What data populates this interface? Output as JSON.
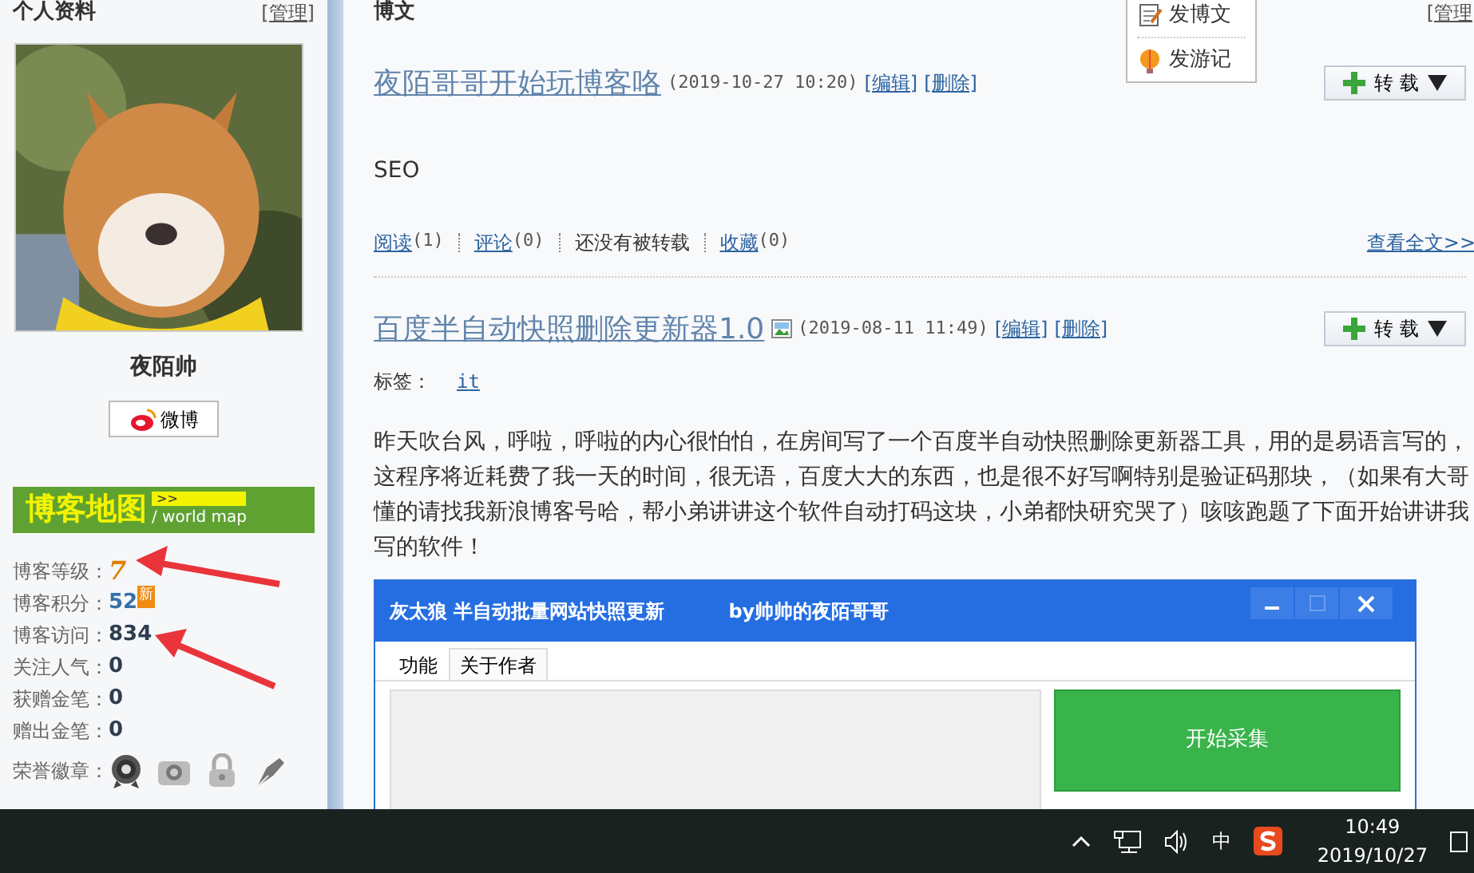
{
  "sidebar": {
    "title": "个人资料",
    "manage": "[管理]",
    "name": "夜陌帅",
    "weibo": "微博",
    "blog_map": {
      "title": "博客地图",
      "arrow": ">>",
      "subtitle": "/ world map"
    },
    "stats": [
      {
        "label": "博客等级：",
        "value": "7",
        "kind": "level"
      },
      {
        "label": "博客积分：",
        "value": "52",
        "kind": "points",
        "badge": "新"
      },
      {
        "label": "博客访问：",
        "value": "834",
        "kind": "plain"
      },
      {
        "label": "关注人气：",
        "value": "0",
        "kind": "plain"
      },
      {
        "label": "获赠金笔：",
        "value": "0",
        "kind": "plain"
      },
      {
        "label": "赠出金笔：",
        "value": "0",
        "kind": "plain"
      }
    ],
    "badges_label": "荣誉徽章："
  },
  "main": {
    "title": "博文",
    "manage": "[管理",
    "menu": [
      "发博文",
      "发游记"
    ],
    "posts": [
      {
        "title": "夜陌哥哥开始玩博客咯",
        "has_image": false,
        "date": "(2019-10-27 10:20)",
        "edit": "[编辑]",
        "delete": "[删除]",
        "share": "转 载",
        "body": "SEO",
        "actions": [
          {
            "kind": "link",
            "label": "阅读",
            "count": "(1)"
          },
          {
            "kind": "link",
            "label": "评论",
            "count": "(0)"
          },
          {
            "kind": "text",
            "label": "还没有被转载"
          },
          {
            "kind": "link",
            "label": "收藏",
            "count": "(0)"
          }
        ],
        "more": "查看全文>>"
      },
      {
        "title": "百度半自动快照删除更新器1.0",
        "has_image": true,
        "date": "(2019-08-11 11:49)",
        "edit": "[编辑]",
        "delete": "[删除]",
        "share": "转 载",
        "tags_label": "标签：",
        "tag": "it",
        "body": "昨天吹台风，呼啦，呼啦的内心很怕怕，在房间写了一个百度半自动快照删除更新器工具，用的是易语言写的，这程序将近耗费了我一天的时间，很无语，百度大大的东西，也是很不好写啊特别是验证码那块，（如果有大哥懂的请找我新浪博客号哈，帮小弟讲讲这个软件自动打码这块，小弟都快研究哭了）咳咳跑题了下面开始讲讲我写的软件！"
      }
    ]
  },
  "app_window": {
    "title": "灰太狼 半自动批量网站快照更新",
    "author": "by帅帅的夜陌哥哥",
    "tabs": [
      {
        "label": "功能",
        "selected": true
      },
      {
        "label": "关于作者",
        "selected": false
      }
    ],
    "start_button": "开始采集"
  },
  "taskbar": {
    "ime": "中",
    "time": "10:49",
    "date": "2019/10/27"
  }
}
